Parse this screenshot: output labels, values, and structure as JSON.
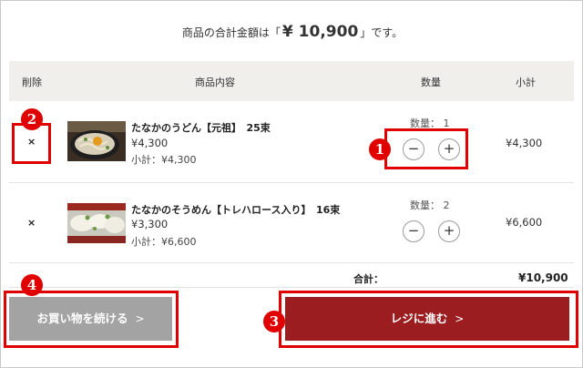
{
  "summary": {
    "prefix": "商品の合計金額は「",
    "amount": "¥ 10,900",
    "suffix": "」です。"
  },
  "table_header": {
    "delete": "削除",
    "item": "商品内容",
    "quantity": "数量",
    "subtotal": "小計"
  },
  "items": [
    {
      "delete_mark": "×",
      "name": "たなかのうどん【元祖】　25束",
      "price": "¥4,300",
      "subtotal_line": "小計：¥4,300",
      "quantity_label": "数量： 1",
      "minus": "−",
      "plus": "+",
      "subtotal": "¥4,300"
    },
    {
      "delete_mark": "×",
      "name": "たなかのそうめん【トレハロース入り】　16束",
      "price": "¥3,300",
      "subtotal_line": "小計：¥6,600",
      "quantity_label": "数量： 2",
      "minus": "−",
      "plus": "+",
      "subtotal": "¥6,600"
    }
  ],
  "total": {
    "label": "合計：",
    "value": "¥10,900"
  },
  "buttons": {
    "continue_label": "お買い物を続ける",
    "continue_chevron": ">",
    "register_label": "レジに進む",
    "register_chevron": ">"
  },
  "annotations": {
    "badge_1": "1",
    "badge_2": "2",
    "badge_3": "3",
    "badge_4": "4"
  },
  "colors": {
    "header_bg": "#f1efec",
    "register_button": "#9b1d20",
    "continue_button": "#a3a3a3",
    "annotation_red": "#e00000"
  },
  "icons": {
    "delete": "close-icon",
    "decrease": "minus-icon",
    "increase": "plus-icon"
  }
}
